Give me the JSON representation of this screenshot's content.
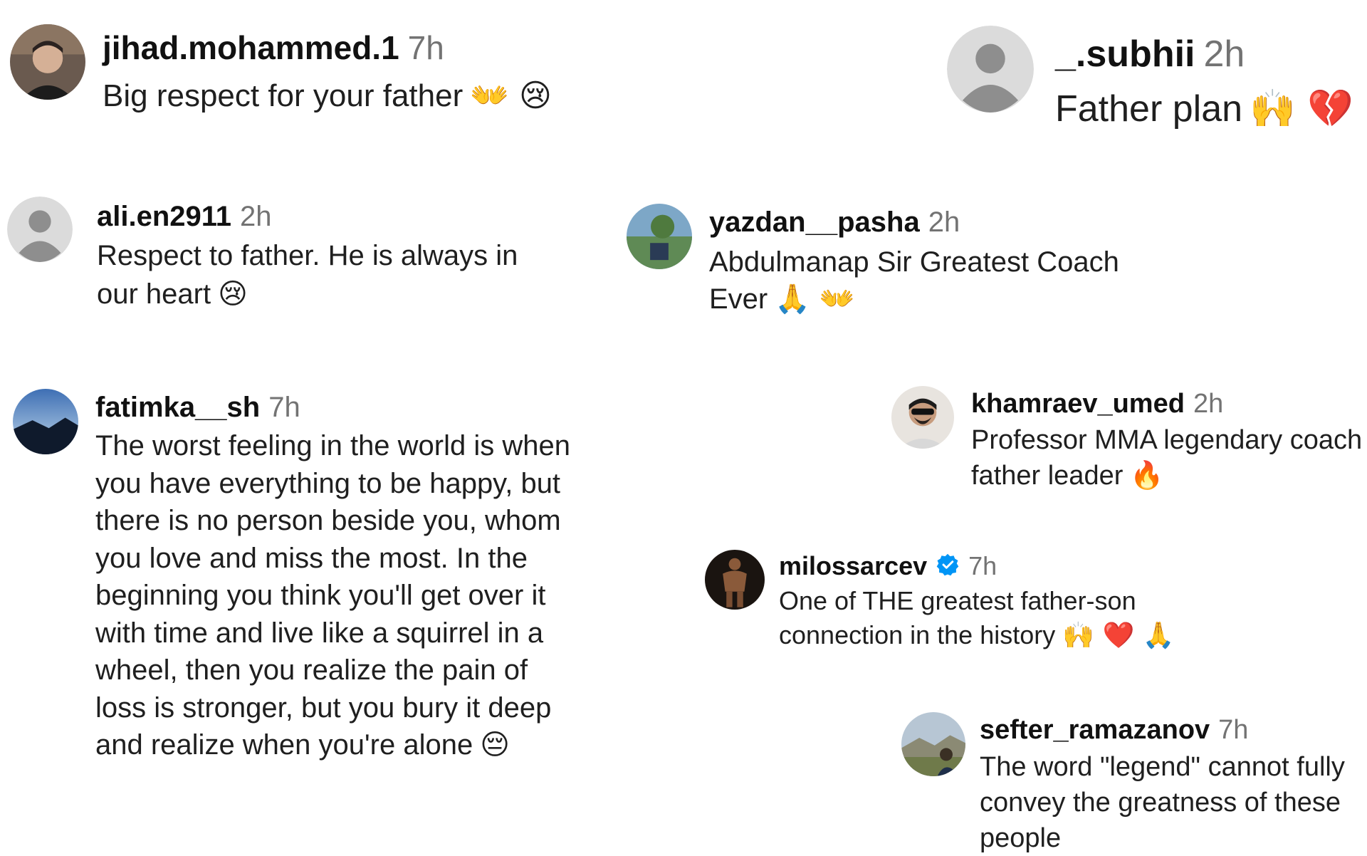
{
  "comments": [
    {
      "username": "jihad.mohammed.1",
      "time": "7h",
      "text": "Big respect for your father",
      "emoji": "👐 😢"
    },
    {
      "username": "_.subhii",
      "time": "2h",
      "text": "Father plan",
      "emoji": "🙌 💔"
    },
    {
      "username": "ali.en2911",
      "time": "2h",
      "text": "Respect to father. He is always in our heart",
      "emoji": "😢"
    },
    {
      "username": "yazdan__pasha",
      "time": "2h",
      "text": "Abdulmanap Sir Greatest Coach Ever",
      "emoji": "🙏 👐"
    },
    {
      "username": "fatimka__sh",
      "time": "7h",
      "text": "The worst feeling in the world is when you have everything to be happy, but there is no person beside you, whom you love and miss the most. In the beginning you think you'll get over it with time and live like a squirrel in a wheel, then you realize the pain of loss is stronger, but you bury it deep and realize when you're alone",
      "emoji": "😔"
    },
    {
      "username": "khamraev_umed",
      "time": "2h",
      "text": "Professor MMA legendary coach father leader",
      "emoji": "🔥"
    },
    {
      "username": "milossarcev",
      "time": "7h",
      "text": "One of THE greatest father-son connection in the history",
      "emoji": "🙌 ❤️ 🙏"
    },
    {
      "username": "sefter_ramazanov",
      "time": "7h",
      "text": "The word \"legend\" cannot fully convey the greatness of these people",
      "emoji": ""
    }
  ],
  "colors": {
    "text": "#262626",
    "secondary": "#737373",
    "verified": "#0095f6",
    "avatar_placeholder": "#dbdbdb",
    "avatar_silhouette": "#8e8e8e"
  },
  "icons": {
    "default_avatar": "default-avatar-icon",
    "verified": "verified-badge-icon"
  }
}
